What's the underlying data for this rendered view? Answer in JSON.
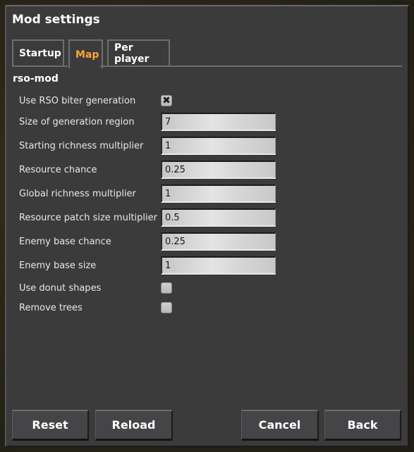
{
  "window": {
    "title": "Mod settings"
  },
  "tabs": [
    {
      "label": "Startup",
      "active": false
    },
    {
      "label": "Map",
      "active": true
    },
    {
      "label": "Per player",
      "active": false
    }
  ],
  "mod_name": "rso-mod",
  "settings": [
    {
      "label": "Use RSO biter generation",
      "type": "checkbox",
      "checked": true,
      "mark": "✖"
    },
    {
      "label": "Size of generation region",
      "type": "text",
      "value": "7"
    },
    {
      "label": "Starting richness multiplier",
      "type": "text",
      "value": "1"
    },
    {
      "label": "Resource chance",
      "type": "text",
      "value": "0.25"
    },
    {
      "label": "Global richness multiplier",
      "type": "text",
      "value": "1"
    },
    {
      "label": "Resource patch size multiplier",
      "type": "text",
      "value": "0.5"
    },
    {
      "label": "Enemy base chance",
      "type": "text",
      "value": "0.25"
    },
    {
      "label": "Enemy base size",
      "type": "text",
      "value": "1"
    },
    {
      "label": "Use donut shapes",
      "type": "checkbox",
      "checked": false,
      "mark": ""
    },
    {
      "label": "Remove trees",
      "type": "checkbox",
      "checked": false,
      "mark": ""
    }
  ],
  "buttons": {
    "reset": "Reset",
    "reload": "Reload",
    "cancel": "Cancel",
    "back": "Back"
  },
  "colors": {
    "active_tab": "#ffa533",
    "panel": "#3b3b3b"
  }
}
